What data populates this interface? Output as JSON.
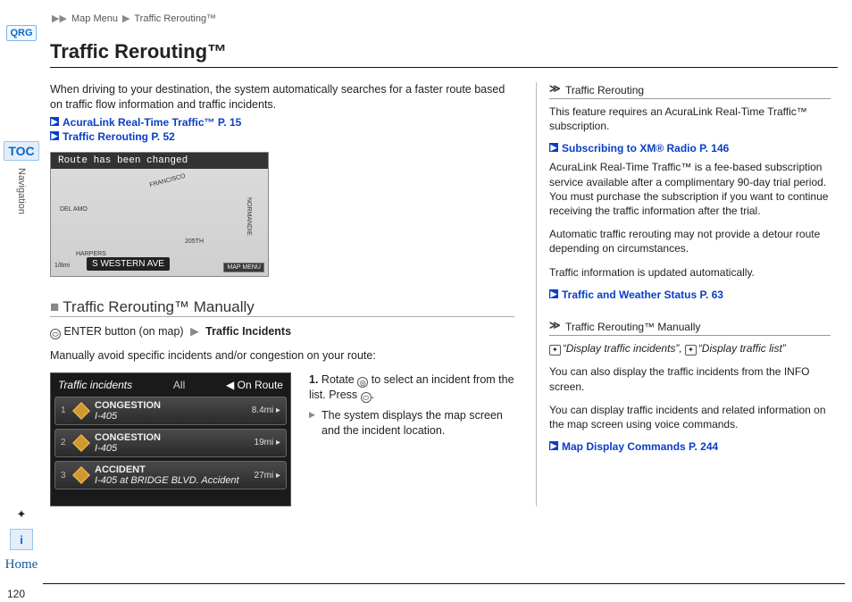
{
  "breadcrumb": {
    "seg1": "Map Menu",
    "seg2": "Traffic Rerouting™"
  },
  "rail": {
    "qrg": "QRG",
    "toc": "TOC",
    "nav": "Navigation",
    "home": "Home"
  },
  "title": "Traffic Rerouting™",
  "intro": "When driving to your destination, the system automatically searches for a faster route based on traffic flow information and traffic incidents.",
  "xrefs": {
    "rt_traffic": "AcuraLink Real-Time Traffic™ P. 15",
    "rerouting": "Traffic Rerouting P. 52",
    "xm": "Subscribing to XM® Radio P. 146",
    "weather": "Traffic and Weather Status P. 63",
    "mapcmd": "Map Display Commands P. 244"
  },
  "map_figure": {
    "banner": "Route has been changed",
    "street_bar": "S WESTERN AVE",
    "labels": {
      "del_amo": "DEL AMO",
      "harpers": "HARPERS",
      "francisco": "FRANCISCO",
      "normandie": "NORMANDIE",
      "st205": "205TH",
      "scale": "1/8mi"
    },
    "menu_btn": "MAP MENU"
  },
  "subhead_manual": "Traffic Rerouting™ Manually",
  "action_line": {
    "pre": "ENTER button (on map)",
    "dest": "Traffic Incidents"
  },
  "manual_intro": "Manually avoid specific incidents and/or congestion on your route:",
  "ti_figure": {
    "title": "Traffic incidents",
    "tab_all": "All",
    "tab_onroute": "◀ On Route",
    "rows": [
      {
        "num": "1",
        "type": "CONGESTION",
        "road": "I-405",
        "dist": "8.4mi ▸"
      },
      {
        "num": "2",
        "type": "CONGESTION",
        "road": "I-405",
        "dist": "19mi ▸"
      },
      {
        "num": "3",
        "type": "ACCIDENT",
        "road": "I-405 at BRIDGE BLVD. Accident",
        "dist": "27mi ▸"
      }
    ]
  },
  "steps": {
    "s1a": "Rotate",
    "s1b": "to select an incident from the list. Press",
    "s1c": ".",
    "sub1": "The system displays the map screen and the incident location."
  },
  "sidebar": {
    "h1": "Traffic Rerouting",
    "p1": "This feature requires an AcuraLink Real-Time Traffic™ subscription.",
    "p2": "AcuraLink Real-Time Traffic™ is a fee-based subscription service available after a complimentary 90-day trial period. You must purchase the subscription if you want to continue receiving the traffic information after the trial.",
    "p3": "Automatic traffic rerouting may not provide a detour route depending on circumstances.",
    "p4": "Traffic information is updated automatically.",
    "h2": "Traffic Rerouting™ Manually",
    "vc1": "“Display traffic incidents”",
    "vc2": "“Display traffic list”",
    "p5": "You can also display the traffic incidents from the INFO screen.",
    "p6": "You can display traffic incidents and related information on the map screen using voice commands."
  },
  "page_number": "120"
}
